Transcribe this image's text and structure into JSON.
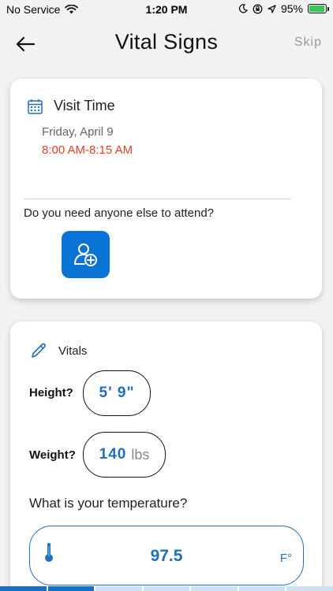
{
  "status_bar": {
    "carrier": "No Service",
    "time": "1:20 PM",
    "battery_percent": "95%",
    "battery_level": 0.95,
    "icons": [
      "wifi-icon",
      "moon-icon",
      "lock-rotation-icon",
      "location-arrow-icon",
      "battery-charging-icon"
    ]
  },
  "header": {
    "title": "Vital Signs",
    "skip_label": "Skip",
    "back_icon": "back-arrow-icon"
  },
  "visit": {
    "title": "Visit Time",
    "date": "Friday, April 9",
    "time_range": "8:00 AM-8:15 AM",
    "attend_question": "Do you need anyone else to attend?",
    "icon": "calendar-icon",
    "add_icon": "add-person-icon"
  },
  "vitals": {
    "title": "Vitals",
    "icon": "pencil-icon",
    "height_label": "Height?",
    "height_value": "5' 9\"",
    "weight_label": "Weight?",
    "weight_value": "140",
    "weight_unit": "lbs",
    "temperature_question": "What is your temperature?",
    "temperature_value": "97.5",
    "temperature_unit": "F°",
    "temperature_icon": "thermometer-icon"
  },
  "progress": {
    "segments_total": 7,
    "segments_active": 2
  },
  "colors": {
    "accent": "#0a73d6",
    "value_blue": "#1f6fbf",
    "time_red": "#e0402a",
    "battery_green": "#34c759"
  }
}
